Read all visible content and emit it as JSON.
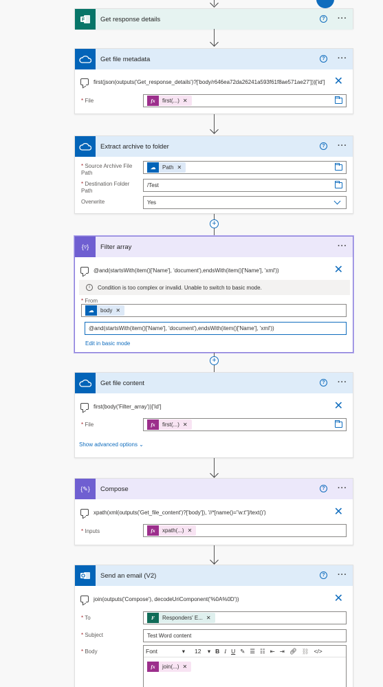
{
  "icons": {
    "forms": "forms-icon",
    "onedrive": "onedrive-cloud-icon",
    "filter": "filter-array-icon",
    "compose": "compose-icon",
    "outlook": "outlook-icon",
    "help": "help-icon",
    "more": "more-options-icon",
    "comment": "comment-icon",
    "close": "close-icon",
    "folder": "folder-icon",
    "expression": "fx-icon"
  },
  "colors": {
    "accent": "#0f6cbd",
    "forms": "#077568",
    "onedrive": "#0364b8",
    "data_ops": "#6f5fd1",
    "outlook": "#0364b8",
    "expression": "#9c2f8c"
  },
  "actions": [
    {
      "title": "Get response details"
    },
    {
      "title": "Get file metadata",
      "comment": "first(json(outputs('Get_response_details')?['body/r646ea72da26241a593f61f8ae571ae27']))['id']",
      "fields": [
        {
          "label": "File",
          "required": true,
          "token": "first(...)"
        }
      ]
    },
    {
      "title": "Extract archive to folder",
      "fields": [
        {
          "label": "Source Archive File Path",
          "required": true,
          "token": "Path"
        },
        {
          "label": "Destination Folder Path",
          "required": true,
          "value": "/Test"
        },
        {
          "label": "Overwrite",
          "required": false,
          "value": "Yes"
        }
      ]
    },
    {
      "title": "Filter array",
      "comment": "@and(startsWith(item()['Name'], 'document'),endsWith(item()['Name'], 'xml'))",
      "warning": "Condition is too complex or invalid. Unable to switch to basic mode.",
      "from_label": "From",
      "from_token": "body",
      "condition": "@and(startsWith(item()['Name'], 'document'),endsWith(item()['Name'], 'xml'))",
      "basic_mode_link": "Edit in basic mode"
    },
    {
      "title": "Get file content",
      "comment": "first(body('Filter_array'))['Id']",
      "fields": [
        {
          "label": "File",
          "required": true,
          "token": "first(...)"
        }
      ],
      "advanced_link": "Show advanced options"
    },
    {
      "title": "Compose",
      "comment": "xpath(xml(outputs('Get_file_content')?['body']), '//*[name()=\"w:t\"]/text()')",
      "fields": [
        {
          "label": "Inputs",
          "required": true,
          "token": "xpath(...)"
        }
      ]
    },
    {
      "title": "Send an email (V2)",
      "comment": "join(outputs('Compose'), decodeUriComponent('%0A%0D'))",
      "fields": [
        {
          "label": "To",
          "required": true,
          "token": "Responders' E..."
        },
        {
          "label": "Subject",
          "required": true,
          "value": "Test Word content"
        },
        {
          "label": "Body",
          "required": true,
          "token": "join(...)",
          "font": "Font",
          "font_size": "12"
        }
      ]
    }
  ]
}
